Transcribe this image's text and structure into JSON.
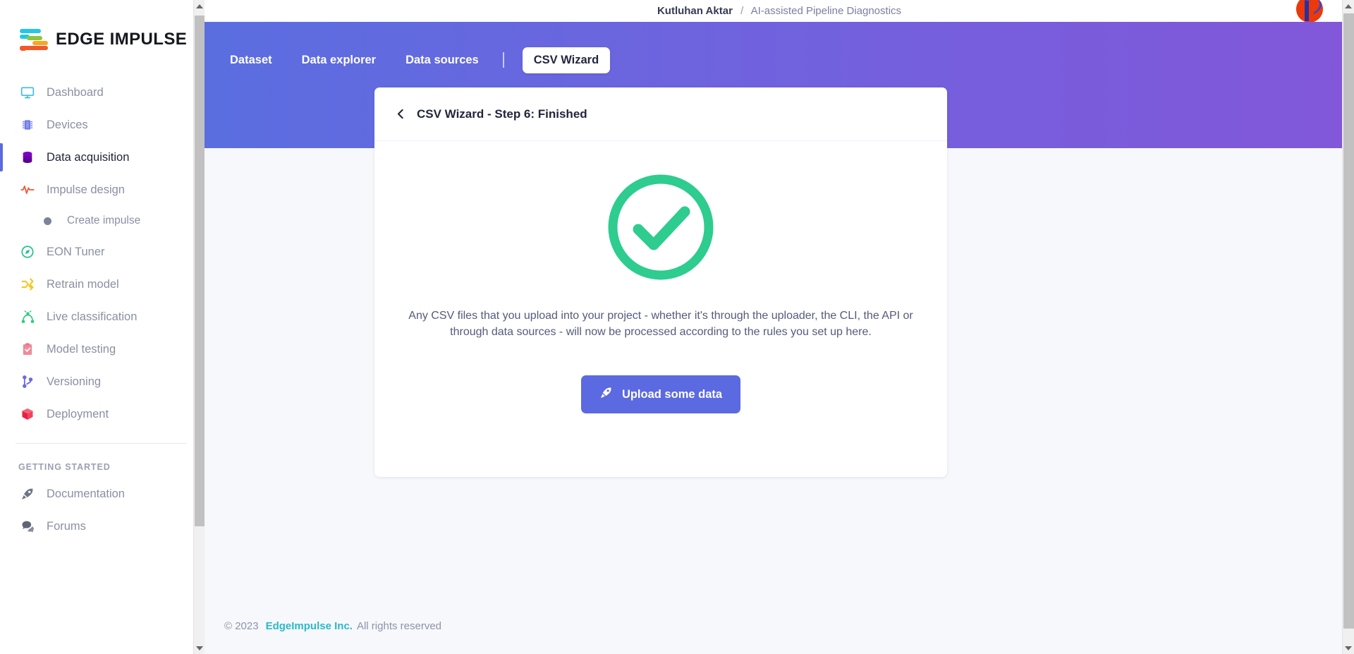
{
  "sidebar": {
    "logo_text": "EDGE IMPULSE",
    "items": [
      {
        "label": "Dashboard",
        "icon": "monitor-icon",
        "active": false
      },
      {
        "label": "Devices",
        "icon": "chip-icon",
        "active": false
      },
      {
        "label": "Data acquisition",
        "icon": "database-icon",
        "active": true
      },
      {
        "label": "Impulse design",
        "icon": "pulse-icon",
        "active": false
      },
      {
        "label": "EON Tuner",
        "icon": "compass-icon",
        "active": false
      },
      {
        "label": "Retrain model",
        "icon": "shuffle-icon",
        "active": false
      },
      {
        "label": "Live classification",
        "icon": "network-icon",
        "active": false
      },
      {
        "label": "Model testing",
        "icon": "clipboard-check-icon",
        "active": false
      },
      {
        "label": "Versioning",
        "icon": "git-branch-icon",
        "active": false
      },
      {
        "label": "Deployment",
        "icon": "box-icon",
        "active": false
      }
    ],
    "sub_item": {
      "label": "Create impulse",
      "icon": "dot-icon"
    },
    "section_title": "GETTING STARTED",
    "bottom_items": [
      {
        "label": "Documentation",
        "icon": "rocket-icon"
      },
      {
        "label": "Forums",
        "icon": "chat-icon"
      }
    ]
  },
  "header": {
    "owner": "Kutluhan Aktar",
    "separator": "/",
    "project": "AI-assisted Pipeline Diagnostics"
  },
  "tabs": [
    {
      "label": "Dataset",
      "active": false
    },
    {
      "label": "Data explorer",
      "active": false
    },
    {
      "label": "Data sources",
      "active": false
    },
    {
      "label": "CSV Wizard",
      "active": true
    }
  ],
  "card": {
    "title": "CSV Wizard - Step 6: Finished",
    "back_icon": "chevron-left-icon",
    "status_icon": "check-circle-icon",
    "blurb": "Any CSV files that you upload into your project - whether it's through the uploader, the CLI, the API or through data sources - will now be processed according to the rules you set up here.",
    "button_label": "Upload some data",
    "button_icon": "rocket-icon"
  },
  "footer": {
    "copyright": "© 2023",
    "brand": "EdgeImpulse Inc.",
    "rights": "All rights reserved"
  },
  "colors": {
    "accent": "#5b6ae0",
    "banner_start": "#5a6ee0",
    "banner_end": "#8257d9",
    "success": "#2ecc8f",
    "brand_teal": "#2cb9c8"
  }
}
